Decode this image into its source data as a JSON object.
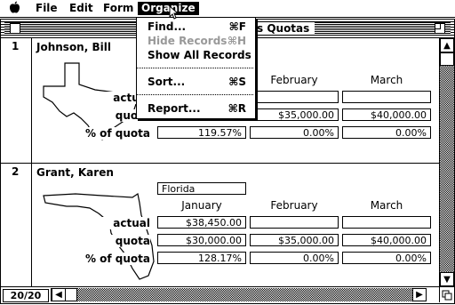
{
  "menubar": {
    "apple": "",
    "items": [
      "File",
      "Edit",
      "Form",
      "Organize"
    ],
    "active": "Organize"
  },
  "window": {
    "title_partial": "s Quotas",
    "record_counter": "20/20"
  },
  "organize_menu": {
    "items": [
      {
        "label": "Find...",
        "key": "⌘F",
        "enabled": true
      },
      {
        "label": "Hide Records",
        "key": "⌘H",
        "enabled": false
      },
      {
        "label": "Show All Records",
        "key": "",
        "enabled": true
      },
      {
        "label": "Sort...",
        "key": "⌘S",
        "enabled": true
      },
      {
        "label": "Report...",
        "key": "⌘R",
        "enabled": true
      }
    ]
  },
  "columns": [
    "January",
    "February",
    "March"
  ],
  "row_labels": {
    "actual": "actual",
    "quota": "quota",
    "pct": "% of quota"
  },
  "records": [
    {
      "number": "1",
      "name": "Johnson, Bill",
      "state": "",
      "actual": [
        "",
        "",
        ""
      ],
      "quota": [
        "",
        "$35,000.00",
        "$40,000.00"
      ],
      "pct": [
        "119.57%",
        "0.00%",
        "0.00%"
      ]
    },
    {
      "number": "2",
      "name": "Grant, Karen",
      "state": "Florida",
      "actual": [
        "$38,450.00",
        "",
        ""
      ],
      "quota": [
        "$30,000.00",
        "$35,000.00",
        "$40,000.00"
      ],
      "pct": [
        "128.17%",
        "0.00%",
        "0.00%"
      ]
    }
  ]
}
